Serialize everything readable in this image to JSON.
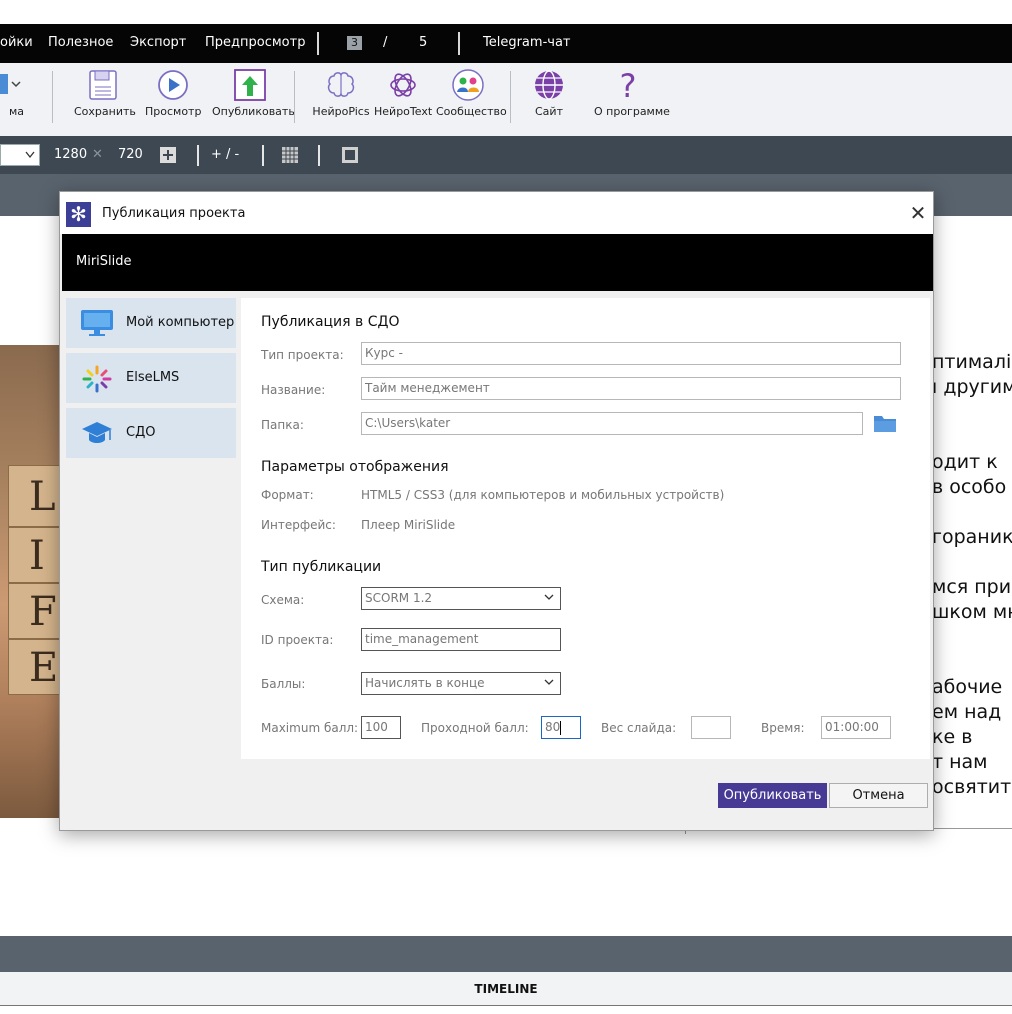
{
  "menubar": {
    "items": [
      "ойки",
      "Полезное",
      "Экспорт",
      "Предпросмотр"
    ],
    "page_current": "3",
    "page_sep": "/",
    "page_total": "5",
    "telegram": "Telegram-чат"
  },
  "toolbar": {
    "partial_label": "ма",
    "save": "Сохранить",
    "preview": "Просмотр",
    "publish": "Опубликовать",
    "neuropics": "НейроPics",
    "neurotext": "НейроText",
    "community": "Сообщество",
    "site": "Сайт",
    "about": "О программе"
  },
  "sizebar": {
    "width": "1280",
    "times": "✕",
    "height": "720",
    "zoom": "+ / -"
  },
  "slide": {
    "photo_letters": [
      "L",
      "I",
      "F",
      "E"
    ],
    "text_lines": [
      "птималі",
      "ı другим",
      "одит к",
      "в особо",
      "гораник",
      "мся при",
      "шком мн",
      "абочие",
      "ем над",
      "ке в",
      "т нам",
      "освятит"
    ]
  },
  "timeline": "TIMELINE",
  "dialog": {
    "title": "Публикация проекта",
    "banner": "MiriSlide",
    "nav": [
      "Мой компьютер",
      "ElseLMS",
      "СДО"
    ],
    "panel": {
      "heading": "Публикация в СДО",
      "project_type_label": "Тип проекта:",
      "project_type_value": "Курс -",
      "name_label": "Название:",
      "name_value": "Тайм менеджемент",
      "folder_label": "Папка:",
      "folder_value": "C:\\Users\\kater",
      "display_heading": "Параметры отображения",
      "format_label": "Формат:",
      "format_value": "HTML5 / CSS3 (для компьютеров и мобильных устройств)",
      "interface_label": "Интерфейс:",
      "interface_value": "Плеер MiriSlide",
      "pub_type_heading": "Тип публикации",
      "scheme_label": "Схема:",
      "scheme_value": "SCORM 1.2",
      "project_id_label": "ID проекта:",
      "project_id_value": "time_management",
      "score_label": "Баллы:",
      "score_value": "Начислять в конце",
      "max_score_label": "Maximum балл:",
      "max_score_value": "100",
      "pass_score_label": "Проходной балл:",
      "pass_score_value": "80",
      "slide_weight_label": "Вес слайда:",
      "slide_weight_value": "",
      "time_label": "Время:",
      "time_value": "01:00:00"
    },
    "publish_button": "Опубликовать",
    "cancel_button": "Отмена"
  },
  "colors": {
    "menubar": "#050505",
    "toolbar": "#f0f2f5",
    "sizebar": "#3d4852",
    "accent_purple": "#473a95",
    "nav_item_bg": "#d9e4ef",
    "folder_icon": "#4a8bd6"
  }
}
